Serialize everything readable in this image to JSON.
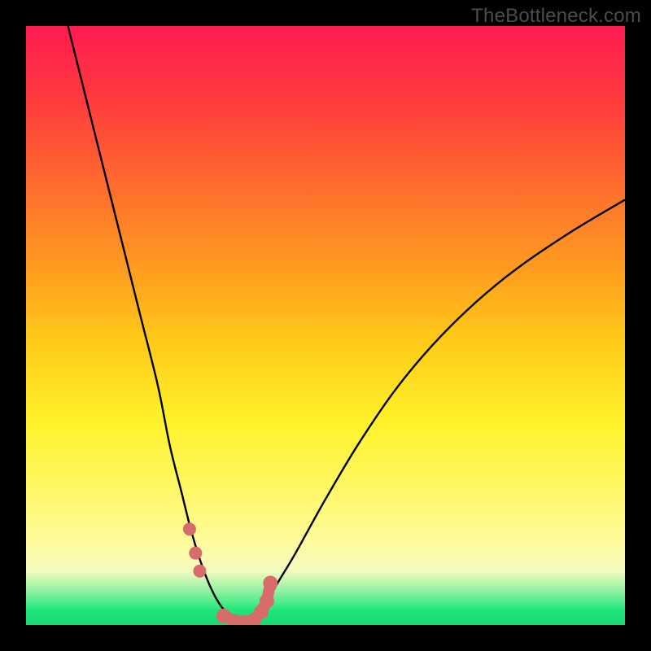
{
  "watermark": "TheBottleneck.com",
  "colors": {
    "frame": "#000000",
    "curve": "#000000",
    "marker": "#d86b6b",
    "gradient_top": "#ff1a50",
    "gradient_bottom": "#18d874"
  },
  "chart_data": {
    "type": "line",
    "title": "",
    "xlabel": "",
    "ylabel": "",
    "xlim": [
      0,
      100
    ],
    "ylim": [
      0,
      100
    ],
    "grid": false,
    "legend": false,
    "note": "Axes are unlabeled in the original image; x and y are normalized to 0-100 based on the plot area. y represents bottleneck percentage (0 = green at bottom, 100 = red at top).",
    "series": [
      {
        "name": "left-curve",
        "x": [
          7,
          10,
          13,
          16,
          19,
          22,
          24,
          26,
          27.5,
          29,
          30.5,
          32,
          33.5,
          35,
          36.5
        ],
        "y": [
          100,
          88,
          76,
          64,
          52,
          40,
          30,
          22,
          16,
          11,
          7,
          4,
          2,
          0.7,
          0
        ]
      },
      {
        "name": "right-curve",
        "x": [
          36.5,
          38,
          40,
          42,
          45,
          50,
          56,
          63,
          71,
          80,
          90,
          100
        ],
        "y": [
          0,
          1,
          3.5,
          7,
          12,
          21,
          31,
          41,
          50,
          58,
          65,
          71
        ]
      }
    ],
    "markers": {
      "name": "highlighted-points",
      "note": "Salmon-colored dots near the valley of the curve",
      "points": [
        {
          "x": 27.3,
          "y": 16
        },
        {
          "x": 28.3,
          "y": 12
        },
        {
          "x": 29.0,
          "y": 9
        },
        {
          "x": 33.0,
          "y": 1.5
        },
        {
          "x": 35.0,
          "y": 0.6
        },
        {
          "x": 36.5,
          "y": 0.4
        },
        {
          "x": 38.0,
          "y": 0.8
        },
        {
          "x": 39.3,
          "y": 2.2
        },
        {
          "x": 40.2,
          "y": 4.0
        },
        {
          "x": 40.8,
          "y": 7.0
        }
      ]
    }
  }
}
